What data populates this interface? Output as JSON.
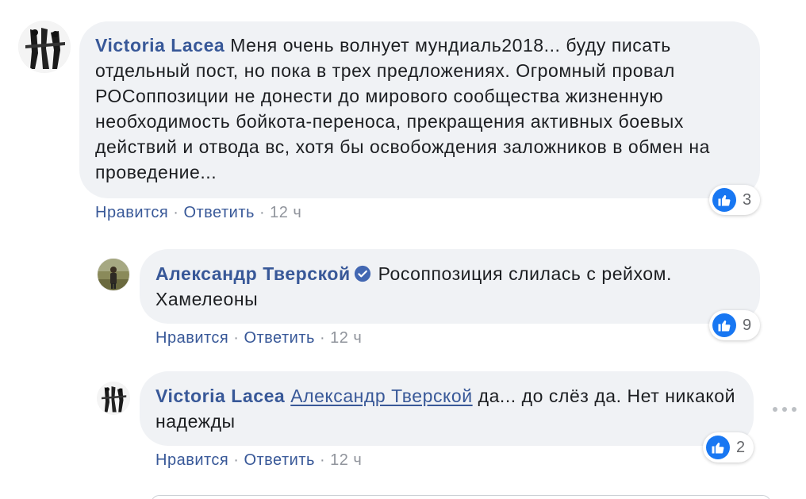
{
  "colors": {
    "author": "#385898",
    "bubble_bg": "#f0f2f5",
    "text": "#1c1e21",
    "meta": "#90949c",
    "like": "#1877f2"
  },
  "comments": [
    {
      "author": "Victoria Lacea",
      "avatar_icon": "profile-photo",
      "text": "Меня очень волнует мундиаль2018... буду писать отдельный пост, но пока в трех предложениях. Огромный провал РОСоппозиции не донести до мирового сообщества жизненную необходимость бойкота-переноса, прекращения активных боевых действий и отвода вс, хотя бы освобождения заложников в обмен на проведение...",
      "like_label": "Нравится",
      "reply_label": "Ответить",
      "separator": "·",
      "time": "12 ч",
      "reaction_icon": "like-icon",
      "reaction_count": "3"
    },
    {
      "author": "Александр Тверской",
      "verified_icon": "verified-badge-icon",
      "avatar_icon": "profile-photo",
      "text": "Росоппозиция слилась с рейхом. Хамелеоны",
      "like_label": "Нравится",
      "reply_label": "Ответить",
      "separator": "·",
      "time": "12 ч",
      "reaction_icon": "like-icon",
      "reaction_count": "9"
    },
    {
      "author": "Victoria Lacea",
      "avatar_icon": "profile-photo",
      "mention": "Александр Тверской",
      "text": "да... до слёз да. Нет никакой надежды",
      "like_label": "Нравится",
      "reply_label": "Ответить",
      "separator": "·",
      "time": "12 ч",
      "reaction_icon": "like-icon",
      "reaction_count": "2",
      "more_icon": "more-options-icon"
    }
  ]
}
